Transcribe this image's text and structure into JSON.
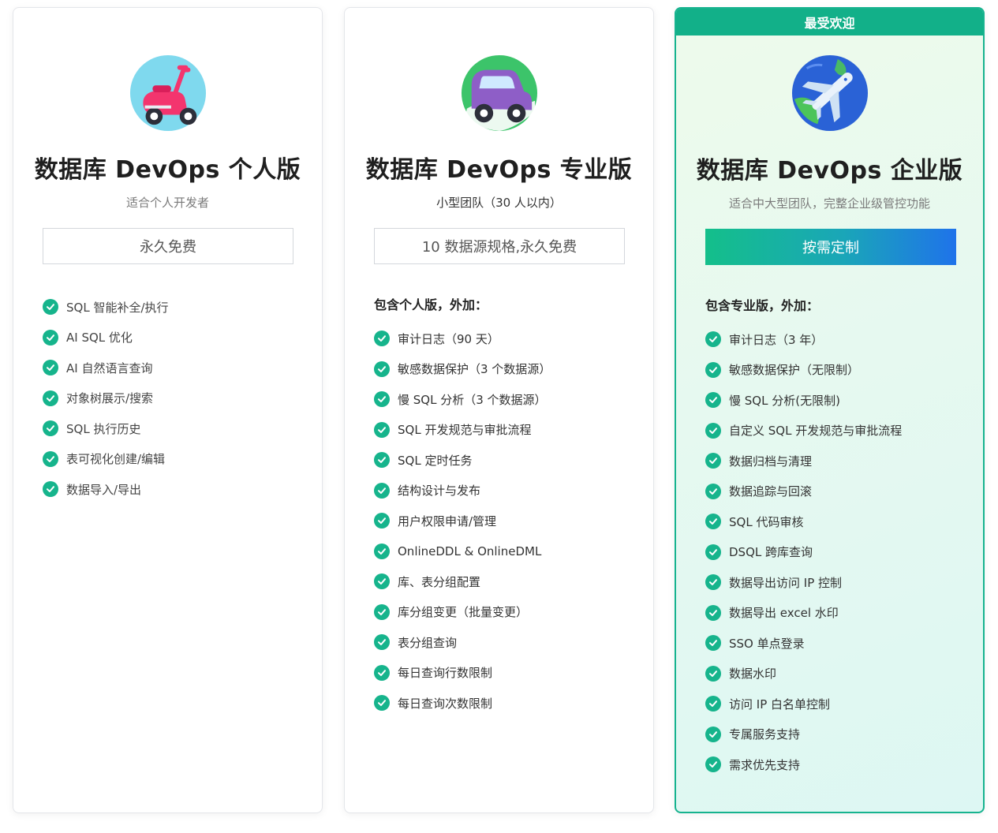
{
  "plans": [
    {
      "title": "数据库 DevOps 个人版",
      "subtitle": "适合个人开发者",
      "cta": "永久免费",
      "features_heading": "",
      "features": [
        "SQL 智能补全/执行",
        "AI SQL 优化",
        "AI 自然语言查询",
        "对象树展示/搜索",
        "SQL 执行历史",
        "表可视化创建/编辑",
        "数据导入/导出"
      ]
    },
    {
      "title": "数据库 DevOps 专业版",
      "subtitle": "小型团队（30 人以内）",
      "cta": "10 数据源规格,永久免费",
      "features_heading": "包含个人版，外加：",
      "features": [
        "审计日志（90 天）",
        "敏感数据保护（3 个数据源）",
        "慢 SQL 分析（3 个数据源）",
        "SQL 开发规范与审批流程",
        "SQL 定时任务",
        "结构设计与发布",
        "用户权限申请/管理",
        "OnlineDDL & OnlineDML",
        "库、表分组配置",
        "库分组变更（批量变更）",
        "表分组查询",
        "每日查询行数限制",
        "每日查询次数限制"
      ]
    },
    {
      "badge": "最受欢迎",
      "title": "数据库 DevOps 企业版",
      "subtitle": "适合中大型团队，完整企业级管控功能",
      "cta": "按需定制",
      "features_heading": "包含专业版，外加：",
      "features": [
        "审计日志（3 年）",
        "敏感数据保护（无限制）",
        "慢 SQL 分析(无限制)",
        "自定义 SQL 开发规范与审批流程",
        "数据归档与清理",
        "数据追踪与回滚",
        "SQL 代码审核",
        "DSQL 跨库查询",
        "数据导出访问 IP 控制",
        "数据导出 excel 水印",
        "SSO 单点登录",
        "数据水印",
        "访问 IP 白名单控制",
        "专属服务支持",
        "需求优先支持"
      ]
    }
  ],
  "colors": {
    "accent_green": "#16b48c",
    "ribbon": "#12b089",
    "cta_gradient": [
      "#14bf8a",
      "#1f73ea"
    ]
  },
  "icons": [
    "scooter-icon",
    "car-icon",
    "airplane-globe-icon",
    "check-circle-icon"
  ]
}
